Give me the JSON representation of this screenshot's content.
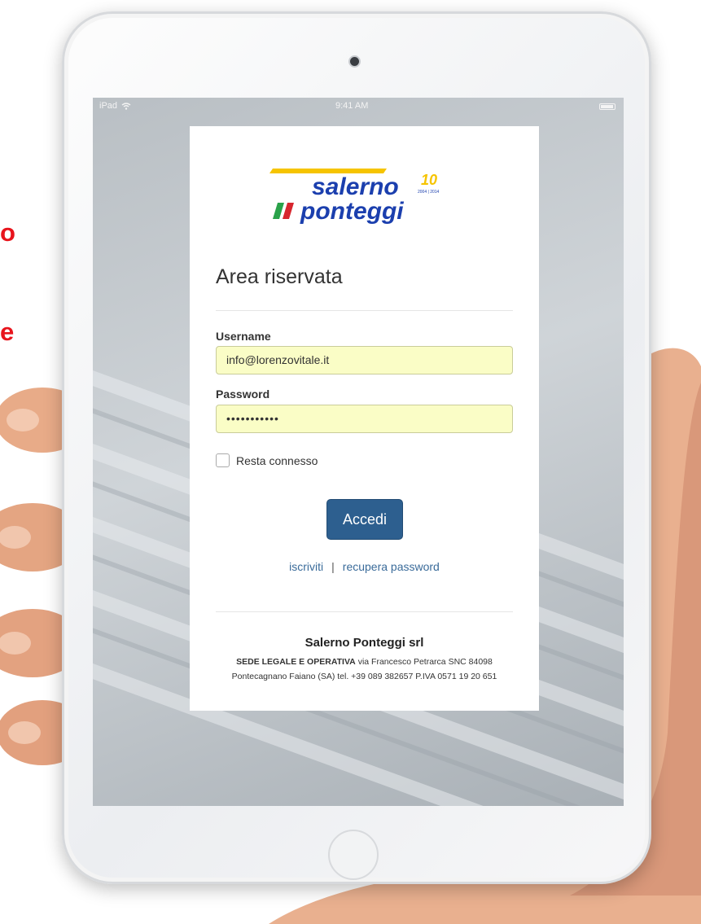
{
  "side_text": {
    "line1": "o",
    "line2": "e"
  },
  "status_bar": {
    "device": "iPad",
    "time": "9:41 AM"
  },
  "login": {
    "heading": "Area riservata",
    "username_label": "Username",
    "username_value": "info@lorenzovitale.it",
    "password_label": "Password",
    "password_value": "•••••••••••",
    "remember_label": "Resta connesso",
    "submit_label": "Accedi",
    "register_link": "iscriviti",
    "separator": "|",
    "recover_link": "recupera password"
  },
  "logo": {
    "line1": "salerno",
    "line2": "ponteggi",
    "badge": "10",
    "years": "2004 | 2014"
  },
  "footer": {
    "company": "Salerno Ponteggi srl",
    "address_label": "SEDE LEGALE E OPERATIVA",
    "address_line1": "via Francesco Petrarca SNC 84098",
    "address_line2": "Pontecagnano Faiano (SA) tel. +39 089 382657 P.IVA 0571 19 20 651"
  },
  "colors": {
    "accent": "#2d5f8f",
    "link": "#3a6b9a",
    "autofill": "#fafdc6",
    "slogan": "#e8141c",
    "logo_blue": "#1b3fae",
    "logo_yellow": "#f6c400"
  }
}
